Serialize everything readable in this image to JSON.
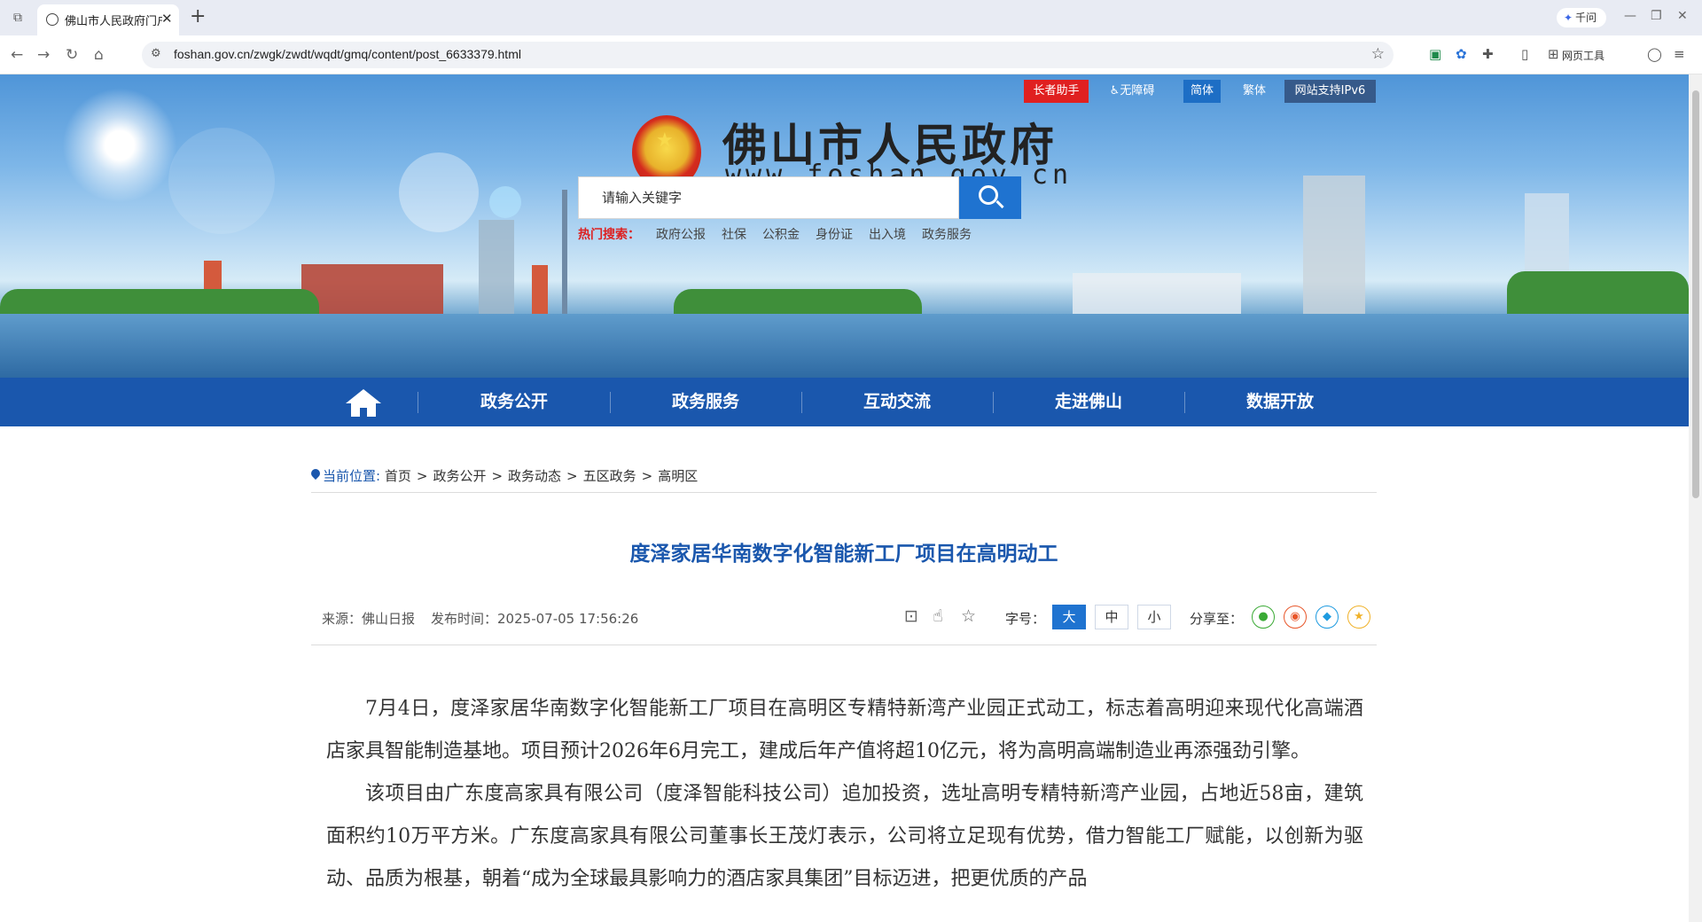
{
  "browser": {
    "tab_title": "佛山市人民政府门户网站",
    "tab_close": "✕",
    "new_tab": "+",
    "url": "foshan.gov.cn/zwgk/zwdt/wqdt/gmq/content/post_6633379.html",
    "qianwen_label": "千问",
    "tools_label": "网页工具",
    "icons": [
      "back-icon",
      "forward-icon",
      "reload-icon",
      "home-icon",
      "bookmark-star-icon",
      "extensions-icon",
      "account-icon",
      "menu-icon"
    ]
  },
  "topbar": {
    "elder": "长者助手",
    "accessible": "无障碍",
    "simplified": "简体",
    "traditional": "繁体",
    "ipv6": "网站支持IPv6"
  },
  "header": {
    "site_title": "佛山市人民政府",
    "site_domain": "www.foshan.gov.cn"
  },
  "search": {
    "placeholder": "请输入关键字",
    "hot_label": "热门搜索：",
    "hot_keywords": [
      "政府公报",
      "社保",
      "公积金",
      "身份证",
      "出入境",
      "政务服务"
    ]
  },
  "nav": {
    "items": [
      "政务公开",
      "政务服务",
      "互动交流",
      "走进佛山",
      "数据开放"
    ]
  },
  "breadcrumb": {
    "label": "当前位置:",
    "items": [
      "首页",
      "政务公开",
      "政务动态",
      "五区政务",
      "高明区"
    ]
  },
  "article": {
    "title": "度泽家居华南数字化智能新工厂项目在高明动工",
    "source": "来源：佛山日报",
    "publish_time": "发布时间：2025-07-05 17:56:26",
    "font_label": "字号：",
    "font_sizes": [
      "大",
      "中",
      "小"
    ],
    "share_label": "分享至：",
    "paragraphs": [
      "7月4日，度泽家居华南数字化智能新工厂项目在高明区专精特新湾产业园正式动工，标志着高明迎来现代化高端酒店家具智能制造基地。项目预计2026年6月完工，建成后年产值将超10亿元，将为高明高端制造业再添强劲引擎。",
      "该项目由广东度高家具有限公司（度泽智能科技公司）追加投资，选址高明专精特新湾产业园，占地近58亩，建筑面积约10万平方米。广东度高家具有限公司董事长王茂灯表示，公司将立足现有优势，借力智能工厂赋能，以创新为驱动、品质为根基，朝着“成为全球最具影响力的酒店家具集团”目标迈进，把更优质的产品"
    ]
  },
  "colors": {
    "nav_blue": "#1a57ad",
    "accent_blue": "#1f73d0",
    "hot_red": "#dd2222",
    "elder_red": "#e02020"
  }
}
